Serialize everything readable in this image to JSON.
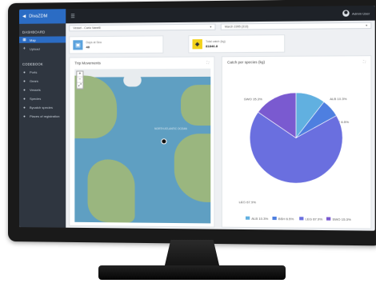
{
  "app": {
    "brand": "DivaZDM",
    "user": "Admin User"
  },
  "sidebar": {
    "dashboard_title": "DASHBOARD",
    "dashboard_items": [
      {
        "label": "Map",
        "active": true
      },
      {
        "label": "Upload",
        "active": false
      }
    ],
    "codebook_title": "CODEBOOK",
    "codebook_items": [
      {
        "label": "Ports"
      },
      {
        "label": "Gears"
      },
      {
        "label": "Vessels"
      },
      {
        "label": "Species"
      },
      {
        "label": "Bycatch species"
      },
      {
        "label": "Places of registration"
      }
    ]
  },
  "filters": {
    "vessel": "Vessel - Carlo Vanelli",
    "month": "March 1995 (313)"
  },
  "stats": [
    {
      "label": "Days at Sea",
      "value": "40",
      "color": "#5aa2dd",
      "icon": "calendar-icon"
    },
    {
      "label": "Total catch (kg)",
      "value": "81846.8",
      "color": "#f2d21b",
      "icon": "fish-icon"
    }
  ],
  "panels": {
    "trip_title": "Trip Movements",
    "catch_title": "Catch per species (kg)",
    "map_label": "NORTH ATLANTIC OCEAN"
  },
  "chart_data": {
    "type": "pie",
    "title": "",
    "categories": [
      "ALB",
      "BSH",
      "LEG",
      "SWO"
    ],
    "series": [
      {
        "values": [
          10.3,
          6.5,
          67.9,
          15.3
        ],
        "colors": [
          "#61b0e0",
          "#4e7fe0",
          "#6a6fdf",
          "#7a5ad0"
        ]
      }
    ],
    "slice_labels": [
      "ALB 10.3%",
      "BSH 6.5%",
      "LEG 67.9%",
      "SWO 15.3%"
    ],
    "legend_position": "bottom"
  }
}
